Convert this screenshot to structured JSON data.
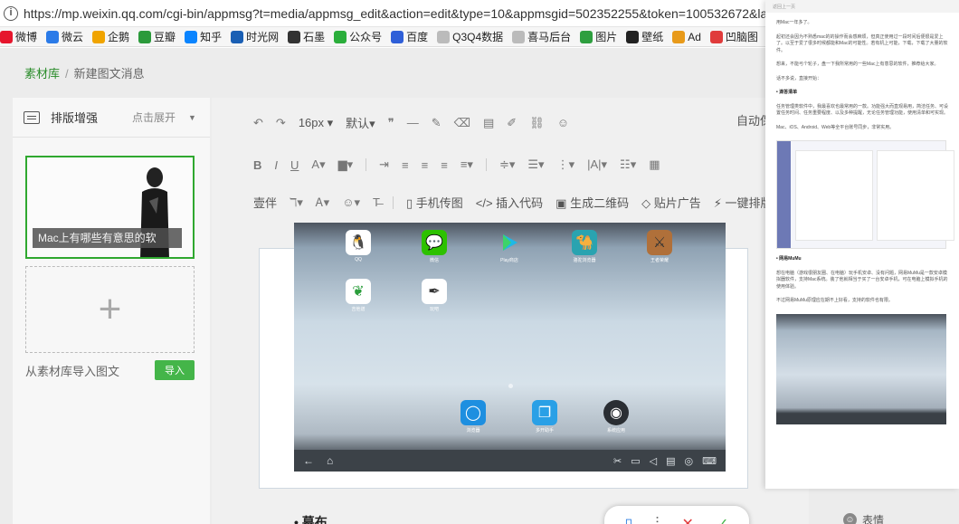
{
  "browser": {
    "url": "https://mp.weixin.qq.com/cgi-bin/appmsg?t=media/appmsg_edit&action=edit&type=10&appmsgid=502352255&token=100532672&lang=zh_"
  },
  "bookmarks": [
    {
      "label": "微博",
      "icon": "weibo-icon",
      "color": "#e6162d"
    },
    {
      "label": "微云",
      "icon": "weiyun-icon",
      "color": "#2b7be8"
    },
    {
      "label": "企鹅",
      "icon": "penguin-icon",
      "color": "#f0a400"
    },
    {
      "label": "豆瓣",
      "icon": "douban-icon",
      "color": "#2b9a3b"
    },
    {
      "label": "知乎",
      "icon": "zhihu-icon",
      "color": "#0a84ff"
    },
    {
      "label": "时光网",
      "icon": "mtime-icon",
      "color": "#1a5fb4"
    },
    {
      "label": "石墨",
      "icon": "shimo-icon",
      "color": "#333333"
    },
    {
      "label": "公众号",
      "icon": "wechat-icon",
      "color": "#2bae3b"
    },
    {
      "label": "百度",
      "icon": "baidu-icon",
      "color": "#2f5fd8"
    },
    {
      "label": "Q3Q4数据",
      "icon": "file-icon",
      "color": "#bbbbbb"
    },
    {
      "label": "喜马后台",
      "icon": "file-icon",
      "color": "#bbbbbb"
    },
    {
      "label": "图片",
      "icon": "image-icon",
      "color": "#2e9f3f"
    },
    {
      "label": "壁纸",
      "icon": "camera-icon",
      "color": "#222222"
    },
    {
      "label": "Ad",
      "icon": "ad-icon",
      "color": "#e89a1a"
    },
    {
      "label": "凹脑图",
      "icon": "mindmap-icon",
      "color": "#e03b3b"
    }
  ],
  "breadcrumb": {
    "root": "素材库",
    "current": "新建图文消息"
  },
  "left_panel": {
    "title": "排版增强",
    "expand": "点击展开",
    "card_caption": "Mac上有哪些有意思的软",
    "import_text": "从素材库导入图文",
    "import_button": "导入"
  },
  "editor": {
    "font_size": "16px",
    "font_family": "默认",
    "auto_save": "自动保",
    "row3": {
      "phone_upload": "手机传图",
      "insert_code": "插入代码",
      "gen_qrcode": "生成二维码",
      "paste_ad": "贴片广告",
      "one_click": "一键排版"
    },
    "row3_lead": "壹伴",
    "bullet_text": "幕布"
  },
  "tablet": {
    "apps": [
      {
        "label": "QQ",
        "icon": "qq-icon"
      },
      {
        "label": "微信",
        "icon": "wechat-icon"
      },
      {
        "label": "Play商店",
        "icon": "play-icon"
      },
      {
        "label": "骆驼浏览器",
        "icon": "camel-icon"
      },
      {
        "label": "王者荣耀",
        "icon": "game-icon"
      },
      {
        "label": "吉他谱",
        "icon": "leaf-icon"
      },
      {
        "label": "玩吧",
        "icon": "pen-icon"
      }
    ],
    "dock": [
      {
        "label": "浏览器",
        "icon": "browser-icon"
      },
      {
        "label": "多开助手",
        "icon": "multi-icon"
      },
      {
        "label": "系统应用",
        "icon": "system-apps-icon"
      }
    ]
  },
  "article": {
    "header": "返回上一页",
    "intro": "用Mac一年多了。",
    "p1": "起初还会因为不熟悉mac的的操作而会感麻烦，但真正使用过一段时间后便很是爱上了。以至于爱了很多时候都能和Mac的可能性。若有机上可能，下载，下载了大量的软件。",
    "p2": "想来，不能弓个轮子，盘一下我所常用的一些Mac上有意思的软件，推荐给大家。",
    "p3": "话不多说，直接开始：",
    "h1": "滴答清单",
    "p4": "任务管理类软件中，我最喜欢也最常用的一款。功能强大而直观易用，简洁任务、可设置任务时间、任务重要程度、以及多种提醒，无论任务管理功能，使用清单和可实现。",
    "p5": "Mac、iOS、Android、Web等全平台账号同步，非常实用。",
    "h2": "网易MuMu",
    "p6": "想在电脑（游戏很朋友圈、在电脑）玩手机安卓、没有问题，网易MuMu是一款安卓模拟器软件，支持Mac系统。装了他就相当于买了一台安卓手机，可在电脑上模拟手机的使用体验。",
    "p7": "不过网易MuMu原理应在期不上好看，支持的软件也有限。"
  },
  "side": {
    "expression": "表情"
  }
}
